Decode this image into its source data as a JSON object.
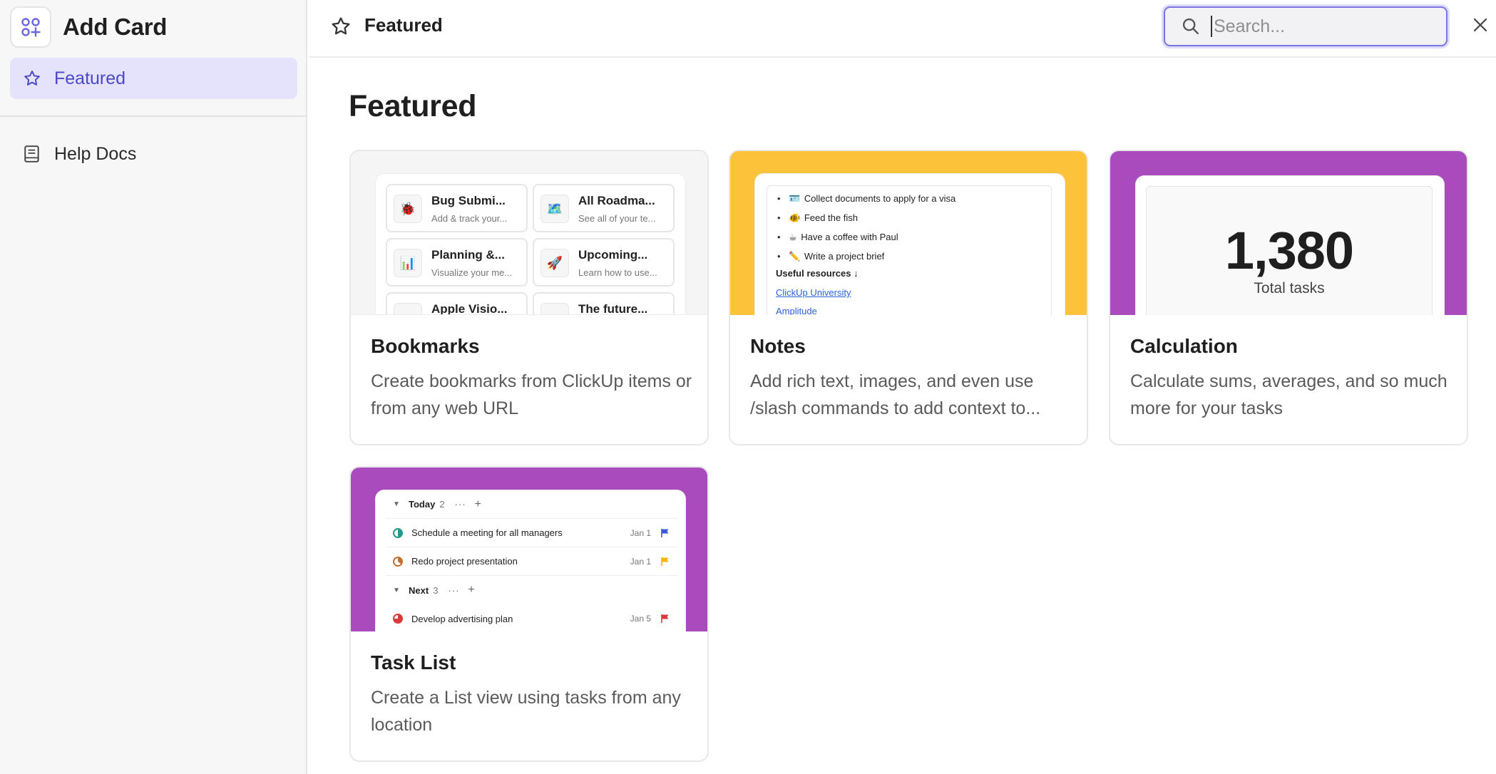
{
  "sidebar": {
    "title": "Add Card",
    "items": [
      {
        "label": "Featured",
        "icon": "star-icon",
        "active": true
      },
      {
        "label": "Help Docs",
        "icon": "book-icon",
        "active": false
      }
    ]
  },
  "topbar": {
    "title": "Featured",
    "search_placeholder": "Search...",
    "search_value": ""
  },
  "main": {
    "heading": "Featured",
    "cards": [
      {
        "name": "Bookmarks",
        "description": "Create bookmarks from ClickUp items or from any web URL",
        "preview_bg": "#f5f5f5",
        "tiles": [
          {
            "emoji": "🐞",
            "title": "Bug Submi...",
            "subtitle": "Add & track your..."
          },
          {
            "emoji": "🗺️",
            "title": "All Roadma...",
            "subtitle": "See all of your te..."
          },
          {
            "emoji": "📊",
            "title": "Planning &...",
            "subtitle": "Visualize your me..."
          },
          {
            "emoji": "🚀",
            "title": "Upcoming...",
            "subtitle": "Learn how to use..."
          },
          {
            "emoji": "",
            "title": "Apple Visio...",
            "subtitle": ""
          },
          {
            "emoji": "🕶️",
            "title": "The future...",
            "subtitle": ""
          }
        ]
      },
      {
        "name": "Notes",
        "description": "Add rich text, images, and even use /slash commands to add context to...",
        "preview_bg": "#fbc23a",
        "bullets": [
          {
            "emoji": "🪪",
            "text": "Collect documents to apply for a visa"
          },
          {
            "emoji": "🐠",
            "text": "Feed the fish"
          },
          {
            "emoji": "☕",
            "text": "Have a coffee with Paul"
          },
          {
            "emoji": "✏️",
            "text": "Write a project brief"
          }
        ],
        "resources_heading": "Useful resources ↓",
        "links": [
          "ClickUp University",
          "Amplitude"
        ]
      },
      {
        "name": "Calculation",
        "description": "Calculate sums, averages, and so much more for your tasks",
        "preview_bg": "#a94bbd",
        "value": "1,380",
        "value_label": "Total tasks"
      },
      {
        "name": "Task List",
        "description": "Create a List view using tasks from any location",
        "preview_bg": "#a94bbd",
        "groups": [
          {
            "label": "Today",
            "count": "2"
          },
          {
            "label": "Next",
            "count": "3"
          }
        ],
        "tasks": [
          {
            "name": "Schedule a meeting for all managers",
            "date": "Jan 1",
            "status_color": "#1f9c8a",
            "flag_color": "#3d57d6"
          },
          {
            "name": "Redo project presentation",
            "date": "Jan 1",
            "status_color": "#c2702a",
            "flag_color": "#f4b400"
          },
          {
            "name": "Develop advertising plan",
            "date": "Jan 5",
            "status_color": "#d93a3a",
            "flag_color": "#d93a3a"
          }
        ]
      }
    ]
  },
  "colors": {
    "accent": "#4b47c9",
    "active_bg": "#e5e3fb",
    "yellow": "#fbc23a",
    "purple": "#a94bbd"
  }
}
